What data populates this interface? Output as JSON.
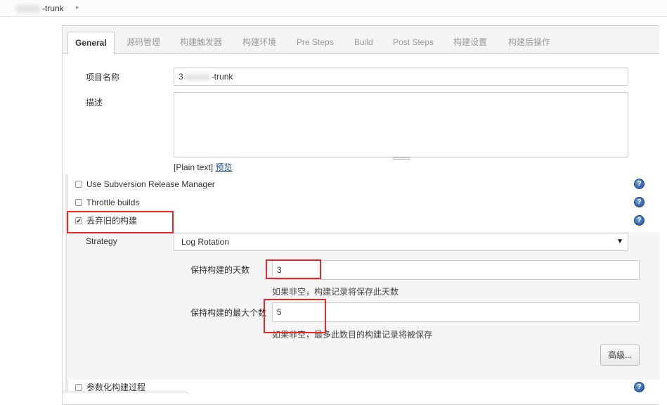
{
  "breadcrumb": {
    "project": "-trunk"
  },
  "tabs": [
    {
      "label": "General"
    },
    {
      "label": "源码管理"
    },
    {
      "label": "构建触发器"
    },
    {
      "label": "构建环境"
    },
    {
      "label": "Pre Steps"
    },
    {
      "label": "Build"
    },
    {
      "label": "Post Steps"
    },
    {
      "label": "构建设置"
    },
    {
      "label": "构建后操作"
    }
  ],
  "general": {
    "project_name_label": "项目名称",
    "project_name_prefix": "3",
    "project_name_suffix": "-trunk",
    "description_label": "描述",
    "description_value": "",
    "plain_text": "[Plain text]",
    "preview_link": "预览"
  },
  "options": [
    {
      "label": "Use Subversion Release Manager",
      "checked": false
    },
    {
      "label": "Throttle builds",
      "checked": false
    },
    {
      "label": "丢弃旧的构建",
      "checked": true
    },
    {
      "label": "参数化构建过程",
      "checked": false
    }
  ],
  "discard": {
    "strategy_label": "Strategy",
    "strategy_value": "Log Rotation",
    "days_label": "保持构建的天数",
    "days_value": "3",
    "days_hint": "如果非空，构建记录将保存此天数",
    "max_label": "保持构建的最大个数",
    "max_value": "5",
    "max_hint": "如果非空，最多此数目的构建记录将被保存",
    "advanced_button": "高级..."
  },
  "icons": {
    "help": "help-icon",
    "checkmark": "✔",
    "caret": "▼",
    "breadcrumb_arrow": "▸"
  },
  "colors": {
    "highlight_box": "#e8272b",
    "help_icon": "#3b6db0",
    "link": "#204a87"
  }
}
